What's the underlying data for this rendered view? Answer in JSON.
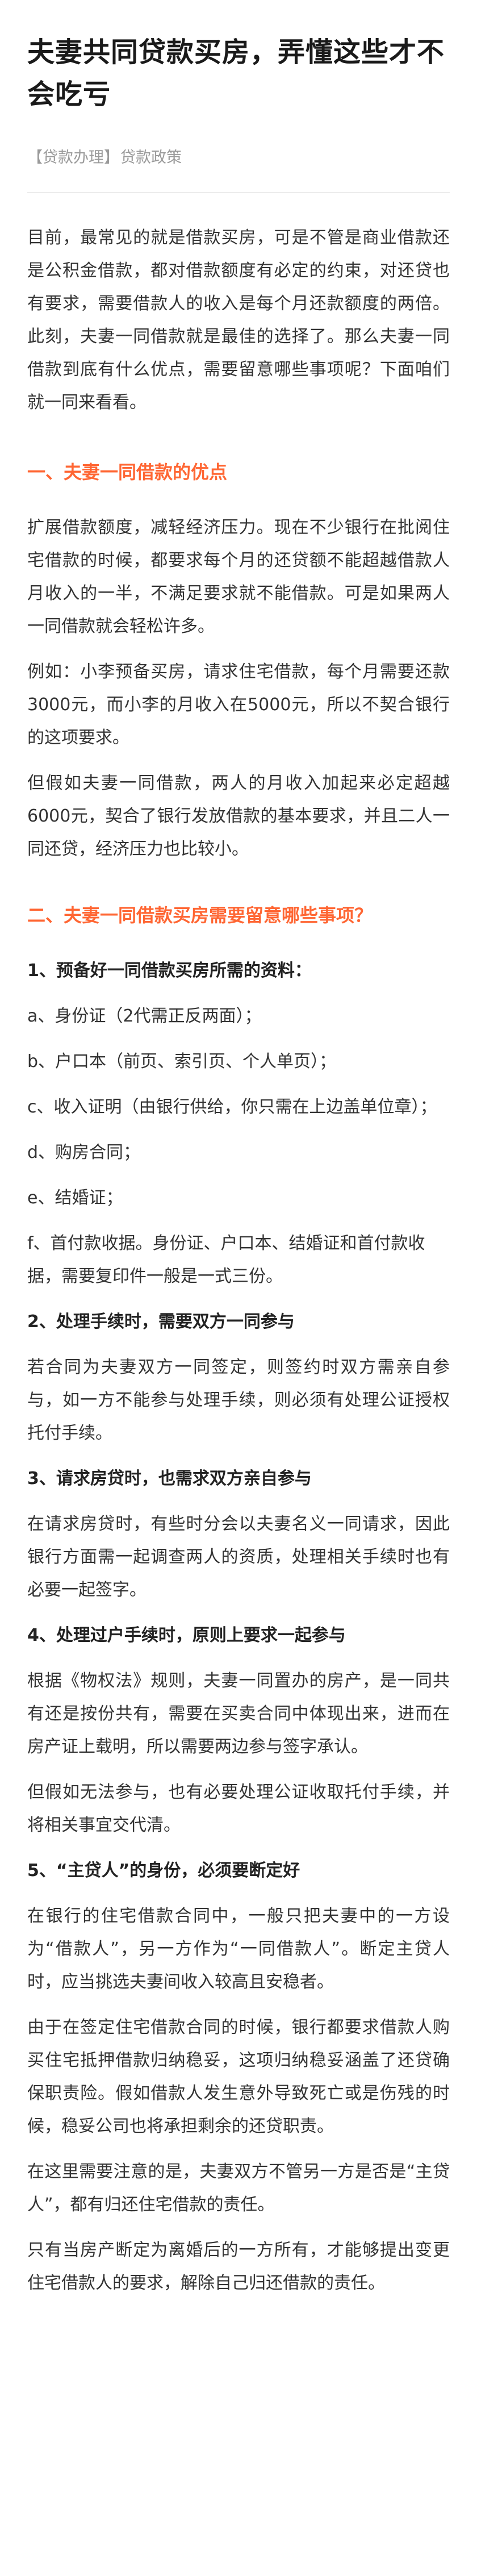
{
  "article": {
    "title": "夫妻共同贷款买房，弄懂这些才不会吃亏",
    "category": "【贷款办理】",
    "tag": "贷款政策",
    "intro": "目前，最常见的就是借款买房，可是不管是商业借款还是公积金借款，都对借款额度有必定的约束，对还贷也有要求，需要借款人的收入是每个月还款额度的两倍。此刻，夫妻一同借款就是最佳的选择了。那么夫妻一同借款到底有什么优点，需要留意哪些事项呢？下面咱们就一同来看看。",
    "section1": {
      "heading": "一、夫妻一同借款的优点",
      "p1": "扩展借款额度，减轻经济压力。现在不少银行在批阅住宅借款的时候，都要求每个月的还贷额不能超越借款人月收入的一半，不满足要求就不能借款。可是如果两人一同借款就会轻松许多。",
      "p2": "例如：小李预备买房，请求住宅借款，每个月需要还款3000元，而小李的月收入在5000元，所以不契合银行的这项要求。",
      "p3": "但假如夫妻一同借款，两人的月收入加起来必定超越6000元，契合了银行发放借款的基本要求，并且二人一同还贷，经济压力也比较小。"
    },
    "section2": {
      "heading": "二、夫妻一同借款买房需要留意哪些事项？",
      "sub1": "1、预备好一同借款买房所需的资料：",
      "items": [
        "a、身份证（2代需正反两面）；",
        "b、户口本（前页、索引页、个人单页）；",
        "c、收入证明（由银行供给，你只需在上边盖单位章）；",
        "d、购房合同；",
        "e、结婚证；",
        "f、首付款收据。身份证、户口本、结婚证和首付款收据，需要复印件一般是一式三份。"
      ],
      "sub2": "2、处理手续时，需要双方一同参与",
      "sub2_text": "若合同为夫妻双方一同签定，则签约时双方需亲自参与，如一方不能参与处理手续，则必须有处理公证授权托付手续。",
      "sub3": "3、请求房贷时，也需求双方亲自参与",
      "sub3_text": "在请求房贷时，有些时分会以夫妻名义一同请求，因此银行方面需一起调查两人的资质，处理相关手续时也有必要一起签字。",
      "sub4": "4、处理过户手续时，原则上要求一起参与",
      "sub4_text1": "根据《物权法》规则，夫妻一同置办的房产，是一同共有还是按份共有，需要在买卖合同中体现出来，进而在房产证上载明，所以需要两边参与签字承认。",
      "sub4_text2": "但假如无法参与，也有必要处理公证收取托付手续，并将相关事宜交代清。",
      "sub5": "5、“主贷人”的身份，必须要断定好",
      "sub5_text1": "在银行的住宅借款合同中，一般只把夫妻中的一方设为“借款人”，另一方作为“一同借款人”。断定主贷人时，应当挑选夫妻间收入较高且安稳者。",
      "sub5_text2": "由于在签定住宅借款合同的时候，银行都要求借款人购买住宅抵押借款归纳稳妥，这项归纳稳妥涵盖了还贷确保职责险。假如借款人发生意外导致死亡或是伤残的时候，稳妥公司也将承担剩余的还贷职责。",
      "sub5_text3": "在这里需要注意的是，夫妻双方不管另一方是否是“主贷人”，都有归还住宅借款的责任。",
      "sub5_text4": "只有当房产断定为离婚后的一方所有，才能够提出变更住宅借款人的要求，解除自己归还借款的责任。"
    }
  },
  "colors": {
    "heading_accent": "#ff6633",
    "body_text": "#333333",
    "meta_text": "#9a9a9a"
  }
}
